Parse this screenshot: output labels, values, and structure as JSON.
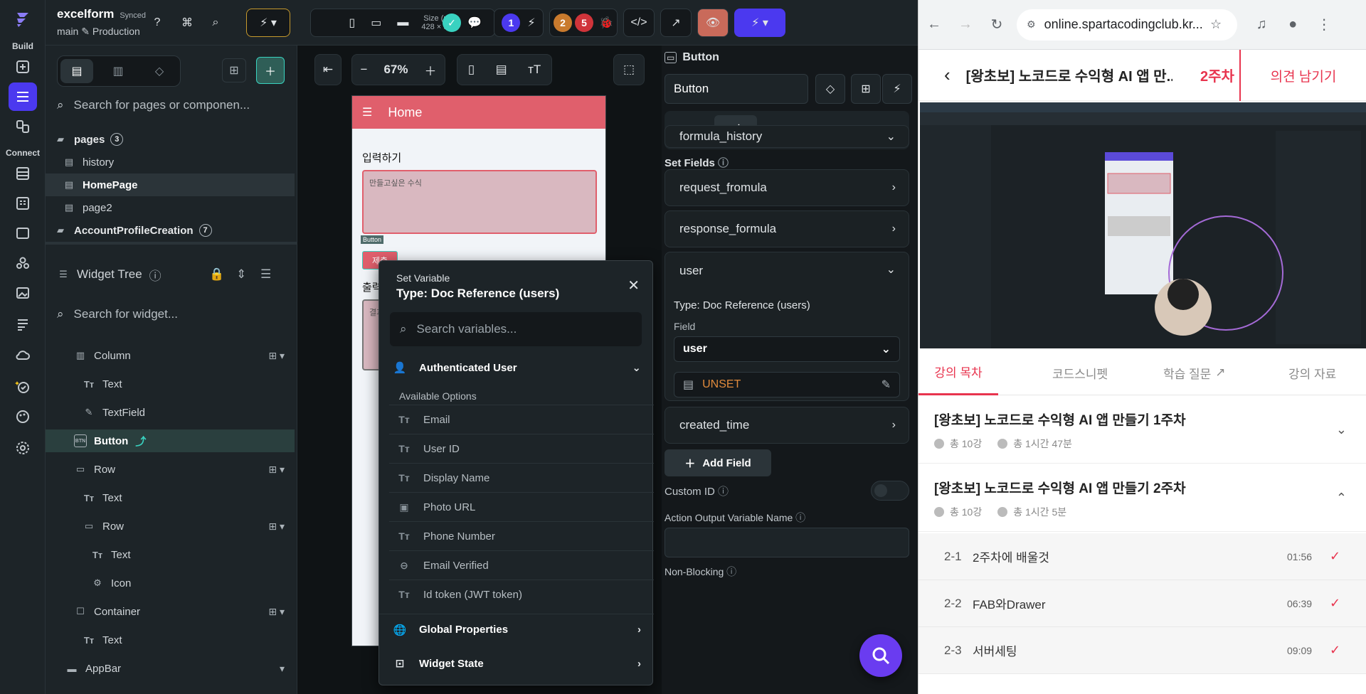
{
  "project": {
    "name": "excelform",
    "status": "Synced",
    "branch": "main",
    "environment": "Production"
  },
  "rail": {
    "build_label": "Build",
    "connect_label": "Connect"
  },
  "topbar": {
    "size_label": "Size (px)",
    "size_value": "428 × 926",
    "version_label": "v1",
    "badge_blue": "1",
    "badge_orange": "2",
    "badge_red": "5"
  },
  "left": {
    "page_search_placeholder": "Search for pages or componen...",
    "pages_label": "pages",
    "pages_count": "3",
    "pages": [
      "history",
      "HomePage",
      "page2"
    ],
    "folder2_label": "AccountProfileCreation",
    "folder2_count": "7",
    "widget_tree_label": "Widget Tree",
    "widget_search_placeholder": "Search for widget...",
    "tree": [
      "Column",
      "Text",
      "TextField",
      "Button",
      "Row",
      "Text",
      "Row",
      "Text",
      "Icon",
      "Container",
      "Text",
      "AppBar"
    ]
  },
  "canvas": {
    "zoom": "67%",
    "phone_title": "Home",
    "input_label": "입력하기",
    "textfield_hint": "만들고싶은 수식",
    "button_tag": "Button",
    "button_text": "제출",
    "output_label": "출력",
    "output_hint": "결과"
  },
  "popup": {
    "title_small": "Set Variable",
    "title_main": "Type: Doc Reference (users)",
    "search_placeholder": "Search variables...",
    "group_auth": "Authenticated User",
    "available": "Available Options",
    "options": [
      "Email",
      "User ID",
      "Display Name",
      "Photo URL",
      "Phone Number",
      "Email Verified",
      "Id token (JWT token)"
    ],
    "group_global": "Global Properties",
    "group_widget": "Widget State"
  },
  "props": {
    "header": "Button",
    "name_value": "Button",
    "collection": "formula_history",
    "set_fields_label": "Set Fields",
    "fields": [
      "request_fromula",
      "response_formula",
      "user",
      "created_time"
    ],
    "type_label": "Type: Doc Reference (users)",
    "field_label": "Field",
    "field_value": "user",
    "unset_label": "UNSET",
    "add_field": "Add Field",
    "custom_id": "Custom ID",
    "action_output": "Action Output Variable Name",
    "non_blocking": "Non-Blocking"
  },
  "browser": {
    "url": "online.spartacodingclub.kr...",
    "lecture_title": "[왕초보] 노코드로 수익형 AI 앱 만...",
    "week_now": "2주차",
    "feedback": "의견 남기기",
    "tabs": [
      "강의 목차",
      "코드스니펫",
      "학습 질문",
      "강의 자료"
    ],
    "weeks": [
      {
        "title": "[왕초보] 노코드로 수익형 AI 앱 만들기 1주차",
        "count": "총 10강",
        "time": "총 1시간 47분"
      },
      {
        "title": "[왕초보] 노코드로 수익형 AI 앱 만들기 2주차",
        "count": "총 10강",
        "time": "총 1시간 5분"
      }
    ],
    "lessons": [
      {
        "no": "2-1",
        "title": "2주차에 배울것",
        "time": "01:56"
      },
      {
        "no": "2-2",
        "title": "FAB와Drawer",
        "time": "06:39"
      },
      {
        "no": "2-3",
        "title": "서버세팅",
        "time": "09:09"
      }
    ]
  }
}
